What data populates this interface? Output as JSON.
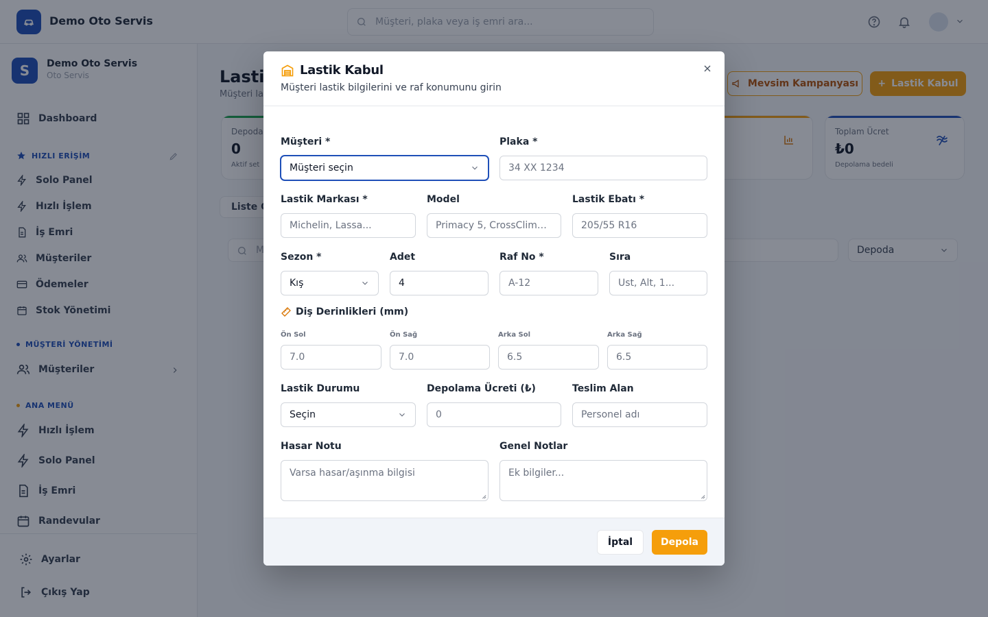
{
  "topbar": {
    "brand": "Demo Oto Servis",
    "search_placeholder": "Müşteri, plaka veya iş emri ara..."
  },
  "sidebar": {
    "org_name": "Demo Oto Servis",
    "org_sub": "Oto Servis",
    "org_initial": "S",
    "dashboard": "Dashboard",
    "quick_access_title": "HIZLI ERİŞİM",
    "quick_items": [
      "Solo Panel",
      "Hızlı İşlem",
      "İş Emri",
      "Müşteriler",
      "Ödemeler",
      "Stok Yönetimi"
    ],
    "customer_mgmt_title": "MÜŞTERİ YÖNETİMİ",
    "customer_item": "Müşteriler",
    "main_menu_title": "ANA MENÜ",
    "main_items": [
      "Hızlı İşlem",
      "Solo Panel",
      "İş Emri",
      "Randevular"
    ],
    "settings": "Ayarlar",
    "logout": "Çıkış Yap"
  },
  "page": {
    "title": "Lastik",
    "subtitle": "Müşteri la",
    "campaign_button": "Mevsim Kampanyası",
    "accept_button": "Lastik Kabul",
    "stat1_label": "Depoda",
    "stat1_value": "0",
    "stat1_foot": "Aktif set",
    "stat4_label": "Toplam Ücret",
    "stat4_value": "₺0",
    "stat4_foot": "Depolama bedeli",
    "list_tab": "Liste G",
    "filter_search": "M",
    "filter_status": "Depoda"
  },
  "modal": {
    "title": "Lastik Kabul",
    "subtitle": "Müşteri lastik bilgilerini ve raf konumunu girin",
    "customer_label": "Müşteri *",
    "customer_value": "Müşteri seçin",
    "plate_label": "Plaka *",
    "plate_placeholder": "34 XX 1234",
    "brand_label": "Lastik Markası *",
    "brand_placeholder": "Michelin, Lassa...",
    "model_label": "Model",
    "model_placeholder": "Primacy 5, CrossClimate...",
    "size_label": "Lastik Ebatı *",
    "size_placeholder": "205/55 R16",
    "season_label": "Sezon *",
    "season_value": "Kış",
    "qty_label": "Adet",
    "qty_value": "4",
    "shelf_label": "Raf No *",
    "shelf_placeholder": "A-12",
    "row_label": "Sıra",
    "row_placeholder": "Üst, Alt, 1...",
    "tread_title": "Diş Derinlikleri (mm)",
    "front_left_label": "Ön Sol",
    "front_left_placeholder": "7.0",
    "front_right_label": "Ön Sağ",
    "front_right_placeholder": "7.0",
    "rear_left_label": "Arka Sol",
    "rear_left_placeholder": "6.5",
    "rear_right_label": "Arka Sağ",
    "rear_right_placeholder": "6.5",
    "condition_label": "Lastik Durumu",
    "condition_value": "Seçin",
    "fee_label": "Depolama Ücreti (₺)",
    "fee_placeholder": "0",
    "receiver_label": "Teslim Alan",
    "receiver_placeholder": "Personel adı",
    "damage_label": "Hasar Notu",
    "damage_placeholder": "Varsa hasar/aşınma bilgisi",
    "notes_label": "Genel Notlar",
    "notes_placeholder": "Ek bilgiler...",
    "cancel_button": "İptal",
    "save_button": "Depola"
  },
  "colors": {
    "brand_blue": "#1e4fb8",
    "accent_orange": "#f59e0b"
  }
}
